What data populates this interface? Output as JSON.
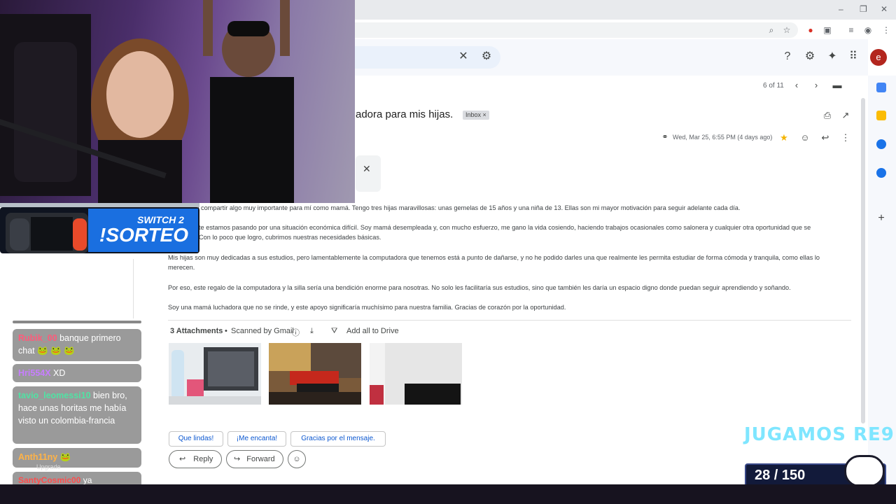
{
  "browser": {
    "window_controls": [
      "–",
      "❐",
      "✕"
    ]
  },
  "gmail": {
    "pagination": "6 of 11",
    "avatar_letter": "e",
    "subject": "adora para mis hijas.",
    "label": "Inbox",
    "date": "Wed, Mar 25, 6:55 PM (4 days ago)",
    "body": [
      "Hoy quiero compartir algo muy importante para mí como mamá. Tengo tres hijas maravillosas: unas gemelas de 15 años y una niña de 13. Ellas son mi mayor motivación para seguir adelante cada día.",
      "te estamos pasando por una situación económica difícil. Soy mamá desempleada y, con mucho esfuerzo, me gano la vida cosiendo, haciendo trabajos ocasionales como salonera y cualquier otra oportunidad que se",
      "Con lo poco que logro, cubrimos nuestras necesidades básicas.",
      "Mis hijas son muy dedicadas a sus estudios, pero lamentablemente la computadora que tenemos está a punto de dañarse, y no he podido darles una que realmente les permita estudiar de forma cómoda y tranquila, como ellas lo",
      "merecen.",
      "Por eso, este regalo de la computadora y la silla sería una bendición enorme para nosotras. No solo les facilitaría sus estudios, sino que también les daría un espacio digno donde puedan seguir aprendiendo y soñando.",
      "Soy una mamá luchadora que no se rinde, y este apoyo significaría muchísimo para nuestra familia. Gracias de corazón por la oportunidad."
    ],
    "attachments": {
      "count_label": "3 Attachments",
      "scanned": "Scanned by Gmail",
      "add_drive": "Add all to Drive"
    },
    "smart_replies": [
      "Que lindas!",
      "¡Me encanta!",
      "Gracias por el mensaje."
    ],
    "reply_label": "Reply",
    "forward_label": "Forward"
  },
  "overlay": {
    "switch_line1": "SWITCH 2",
    "switch_line2": "!SORTEO",
    "goal_title": "JUGAMOS RE9",
    "goal_progress": "28 / 150"
  },
  "chat": [
    {
      "user": "Rubik_00",
      "text": "banque primero chat 🐸 🐸 🐸",
      "color": "#ff5a7a"
    },
    {
      "user": "Hri554X",
      "text": "XD",
      "color": "#c77dff"
    },
    {
      "user": "tavio_leomessi10",
      "text": "bien bro, hace unas horitas me había visto un colombia-francia",
      "color": "#50e3a4"
    },
    {
      "user": "Anth11ny",
      "text": "🐸",
      "color": "#ffb347"
    },
    {
      "user": "SantyCosmic00",
      "text": "ya",
      "color": "#ff4d4d"
    }
  ],
  "chat_upgrade": "Upgrade"
}
